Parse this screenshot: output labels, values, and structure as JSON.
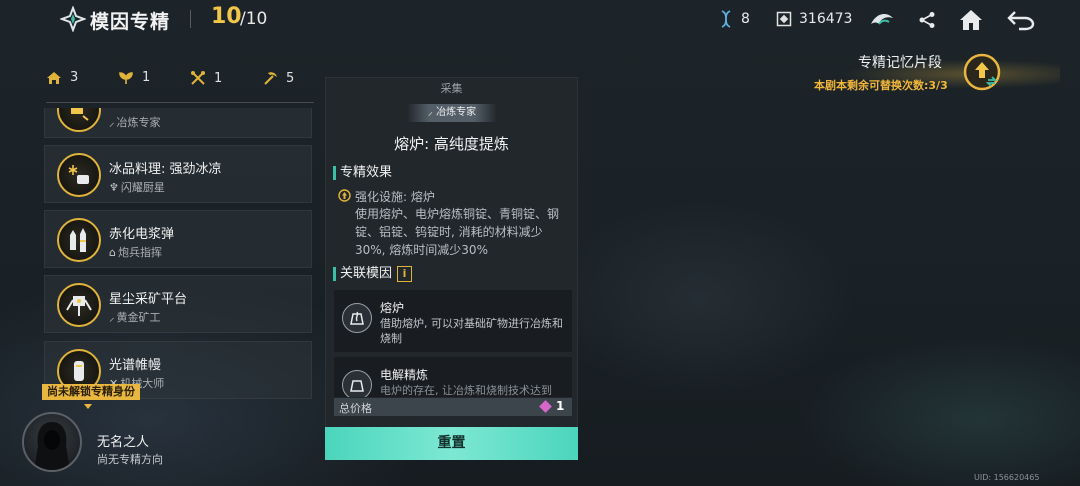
{
  "header": {
    "title": "模因专精",
    "points_current": "10",
    "points_max": "/10",
    "gene_count": "8",
    "coin_count": "316473"
  },
  "memory_fragment": {
    "title": "专精记忆片段",
    "subtitle": "本剧本剩余可替换次数:3/3"
  },
  "counters": [
    {
      "icon": "home-icon",
      "value": "3"
    },
    {
      "icon": "plant-icon",
      "value": "1"
    },
    {
      "icon": "tools-icon",
      "value": "1"
    },
    {
      "icon": "pickaxe-icon",
      "value": "5"
    }
  ],
  "list": {
    "items": [
      {
        "name": "",
        "sub": "冶炼专家",
        "sub_icon": "pickaxe-icon",
        "icon": "smelting-icon"
      },
      {
        "name": "冰品料理: 强劲冰凉",
        "sub": "闪耀厨星",
        "sub_icon": "plant-icon",
        "icon": "ice-food-icon"
      },
      {
        "name": "赤化电浆弹",
        "sub": "炮兵指挥",
        "sub_icon": "home-icon",
        "icon": "plasma-bullet-icon"
      },
      {
        "name": "星尘采矿平台",
        "sub": "黄金矿工",
        "sub_icon": "pickaxe-icon",
        "icon": "mining-platform-icon"
      },
      {
        "name": "光谱帷幔",
        "sub": "机械大师",
        "sub_icon": "tools-icon",
        "icon": "spectrum-curtain-icon"
      }
    ]
  },
  "profile": {
    "lock_tag": "尚未解锁专精身份",
    "name": "无名之人",
    "sub": "尚无专精方向"
  },
  "detail": {
    "category": "采集",
    "tag": "冶炼专家",
    "title": "熔炉: 高纯度提炼",
    "effect_heading": "专精效果",
    "effect_label": "强化设施: 熔炉",
    "effect_text": "使用熔炉、电炉熔炼铜锭、青铜锭、钢锭、铝锭、钨锭时, 消耗的材料减少30%, 熔炼时间减少30%",
    "genes_heading": "关联模因",
    "info_mark": "i",
    "genes": [
      {
        "name": "熔炉",
        "desc": "借助熔炉, 可以对基础矿物进行冶炼和烧制"
      },
      {
        "name": "电解精炼",
        "desc": "电炉的存在, 让冶炼和烧制技术达到"
      }
    ],
    "price_label": "总价格",
    "price_value": "1",
    "reset_label": "重置"
  },
  "footer": {
    "uid": "UID: 156620465"
  },
  "colors": {
    "accent_gold": "#e0b43a",
    "accent_teal": "#4bd5bc",
    "price_gem": "#d468c8"
  }
}
